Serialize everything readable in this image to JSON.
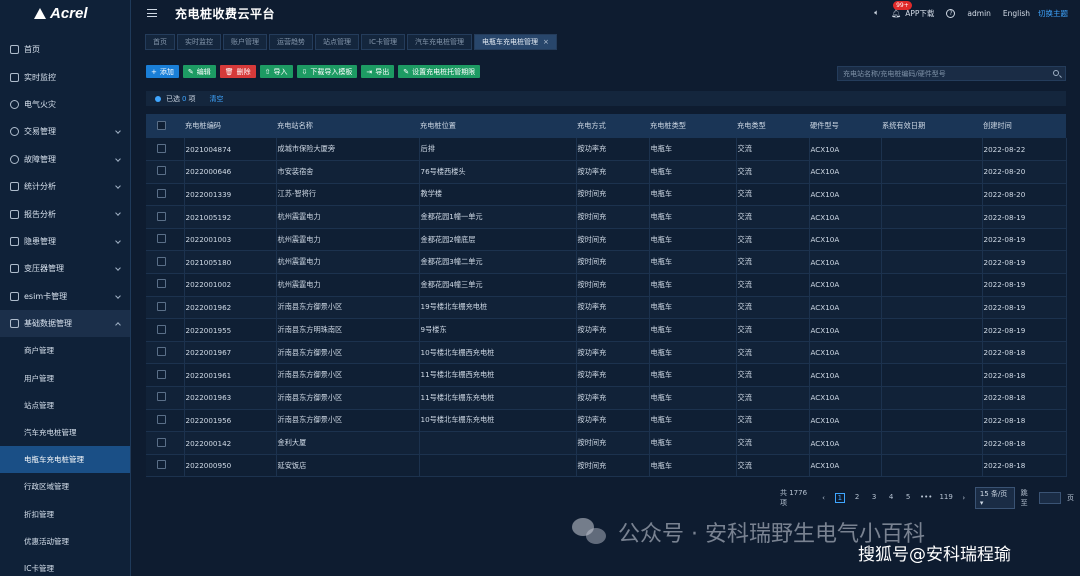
{
  "logo": {
    "text": "Acrel"
  },
  "header": {
    "title": "充电桩收费云平台",
    "badge": "99+",
    "app_download": "APP下载",
    "help": "?",
    "user": "admin",
    "language": "English",
    "theme": "切换主题"
  },
  "sidebar": {
    "items": [
      {
        "label": "首页",
        "icon": "home-icon",
        "expandable": false
      },
      {
        "label": "实时监控",
        "icon": "monitor-icon",
        "expandable": false
      },
      {
        "label": "电气火灾",
        "icon": "fire-icon",
        "expandable": false
      },
      {
        "label": "交易管理",
        "icon": "transaction-icon",
        "expandable": true
      },
      {
        "label": "故障管理",
        "icon": "fault-icon",
        "expandable": true
      },
      {
        "label": "统计分析",
        "icon": "chart-icon",
        "expandable": true
      },
      {
        "label": "报告分析",
        "icon": "report-icon",
        "expandable": true
      },
      {
        "label": "隐患管理",
        "icon": "hazard-icon",
        "expandable": true
      },
      {
        "label": "变压器管理",
        "icon": "transformer-icon",
        "expandable": true
      },
      {
        "label": "esim卡管理",
        "icon": "sim-icon",
        "expandable": true
      },
      {
        "label": "基础数据管理",
        "icon": "database-icon",
        "expandable": true
      }
    ],
    "sub_items": [
      "商户管理",
      "用户管理",
      "站点管理",
      "汽车充电桩管理",
      "电瓶车充电桩管理",
      "行政区域管理",
      "折扣管理",
      "优惠活动管理",
      "IC卡管理"
    ]
  },
  "tabs": [
    {
      "label": "首页"
    },
    {
      "label": "实时监控"
    },
    {
      "label": "账户管理"
    },
    {
      "label": "运营趋势"
    },
    {
      "label": "站点管理"
    },
    {
      "label": "IC卡管理"
    },
    {
      "label": "汽车充电桩管理"
    },
    {
      "label": "电瓶车充电桩管理",
      "close": "×"
    }
  ],
  "toolbar": {
    "add": "添加",
    "edit": "编辑",
    "delete": "删除",
    "import": "导入",
    "download_template": "下载导入模板",
    "export": "导出",
    "set_hosting": "设置充电桩托管期限"
  },
  "search": {
    "placeholder": "充电站名称/充电桩编码/硬件型号"
  },
  "selection": {
    "prefix": "已选",
    "count": "0",
    "suffix": "项",
    "clear": "清空"
  },
  "table": {
    "columns": [
      "充电桩编码",
      "充电站名称",
      "充电桩位置",
      "充电方式",
      "充电桩类型",
      "充电类型",
      "硬件型号",
      "系统有效日期",
      "创建时间"
    ],
    "rows": [
      [
        "2021004874",
        "成城市保险大厦旁",
        "后排",
        "按功率充",
        "电瓶车",
        "交流",
        "ACX10A",
        "",
        "2022-08-22"
      ],
      [
        "2022000646",
        "市安装宿舍",
        "76号楼西楼头",
        "按功率充",
        "电瓶车",
        "交流",
        "ACX10A",
        "",
        "2022-08-20"
      ],
      [
        "2022001339",
        "江苏-智将行",
        "教学楼",
        "按时间充",
        "电瓶车",
        "交流",
        "ACX10A",
        "",
        "2022-08-20"
      ],
      [
        "2021005192",
        "杭州震霆电力",
        "金都花园1幢一单元",
        "按时间充",
        "电瓶车",
        "交流",
        "ACX10A",
        "",
        "2022-08-19"
      ],
      [
        "2022001003",
        "杭州震霆电力",
        "金都花园2幢底层",
        "按时间充",
        "电瓶车",
        "交流",
        "ACX10A",
        "",
        "2022-08-19"
      ],
      [
        "2021005180",
        "杭州震霆电力",
        "金都花园3幢二单元",
        "按时间充",
        "电瓶车",
        "交流",
        "ACX10A",
        "",
        "2022-08-19"
      ],
      [
        "2022001002",
        "杭州震霆电力",
        "金都花园4幢三单元",
        "按时间充",
        "电瓶车",
        "交流",
        "ACX10A",
        "",
        "2022-08-19"
      ],
      [
        "2022001962",
        "沂南县东方御景小区",
        "19号楼北车棚充电桩",
        "按功率充",
        "电瓶车",
        "交流",
        "ACX10A",
        "",
        "2022-08-19"
      ],
      [
        "2022001955",
        "沂南县东方明珠南区",
        "9号楼东",
        "按功率充",
        "电瓶车",
        "交流",
        "ACX10A",
        "",
        "2022-08-19"
      ],
      [
        "2022001967",
        "沂南县东方御景小区",
        "10号楼北车棚西充电桩",
        "按功率充",
        "电瓶车",
        "交流",
        "ACX10A",
        "",
        "2022-08-18"
      ],
      [
        "2022001961",
        "沂南县东方御景小区",
        "11号楼北车棚西充电桩",
        "按功率充",
        "电瓶车",
        "交流",
        "ACX10A",
        "",
        "2022-08-18"
      ],
      [
        "2022001963",
        "沂南县东方御景小区",
        "11号楼北车棚东充电桩",
        "按功率充",
        "电瓶车",
        "交流",
        "ACX10A",
        "",
        "2022-08-18"
      ],
      [
        "2022001956",
        "沂南县东方御景小区",
        "10号楼北车棚东充电桩",
        "按功率充",
        "电瓶车",
        "交流",
        "ACX10A",
        "",
        "2022-08-18"
      ],
      [
        "2022000142",
        "金利大厦",
        "",
        "按时间充",
        "电瓶车",
        "交流",
        "ACX10A",
        "",
        "2022-08-18"
      ],
      [
        "2022000950",
        "延安饭店",
        "",
        "按时间充",
        "电瓶车",
        "交流",
        "ACX10A",
        "",
        "2022-08-18"
      ]
    ]
  },
  "pager": {
    "total": "共 1776 项",
    "prev": "‹",
    "pages": [
      "1",
      "2",
      "3",
      "4",
      "5",
      "•••",
      "119"
    ],
    "next": "›",
    "page_size": "15 条/页",
    "goto": "跳至",
    "page_unit": "页"
  },
  "watermarks": {
    "line1": "公众号 · 安科瑞野生电气小百科",
    "line2": "搜狐号@安科瑞程瑜"
  }
}
